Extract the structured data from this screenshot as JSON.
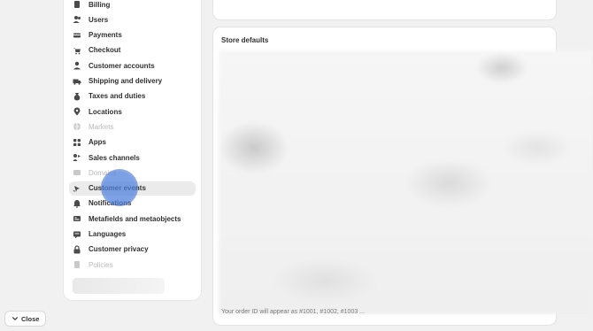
{
  "sidebar": {
    "items": [
      {
        "label": "Billing",
        "icon": "billing-icon",
        "disabled": false,
        "active": false
      },
      {
        "label": "Users",
        "icon": "users-icon",
        "disabled": false,
        "active": false
      },
      {
        "label": "Payments",
        "icon": "payments-icon",
        "disabled": false,
        "active": false
      },
      {
        "label": "Checkout",
        "icon": "cart-icon",
        "disabled": false,
        "active": false
      },
      {
        "label": "Customer accounts",
        "icon": "person-icon",
        "disabled": false,
        "active": false
      },
      {
        "label": "Shipping and delivery",
        "icon": "truck-icon",
        "disabled": false,
        "active": false
      },
      {
        "label": "Taxes and duties",
        "icon": "taxes-icon",
        "disabled": false,
        "active": false
      },
      {
        "label": "Locations",
        "icon": "location-pin-icon",
        "disabled": false,
        "active": false
      },
      {
        "label": "Markets",
        "icon": "globe-icon",
        "disabled": true,
        "active": false
      },
      {
        "label": "Apps",
        "icon": "apps-icon",
        "disabled": false,
        "active": false
      },
      {
        "label": "Sales channels",
        "icon": "sales-channels-icon",
        "disabled": false,
        "active": false
      },
      {
        "label": "Domains",
        "icon": "domains-icon",
        "disabled": true,
        "active": false
      },
      {
        "label": "Customer events",
        "icon": "customer-events-icon",
        "disabled": false,
        "active": true
      },
      {
        "label": "Notifications",
        "icon": "bell-icon",
        "disabled": false,
        "active": false
      },
      {
        "label": "Metafields and metaobjects",
        "icon": "metafields-icon",
        "disabled": false,
        "active": false
      },
      {
        "label": "Languages",
        "icon": "languages-icon",
        "disabled": false,
        "active": false
      },
      {
        "label": "Customer privacy",
        "icon": "lock-icon",
        "disabled": false,
        "active": false
      },
      {
        "label": "Policies",
        "icon": "policies-icon",
        "disabled": true,
        "active": false
      }
    ]
  },
  "main": {
    "store_defaults_title": "Store defaults",
    "order_id_text": "Your order ID will appear as #1001, #1002, #1003 ..."
  },
  "footer": {
    "close_label": "Close"
  }
}
